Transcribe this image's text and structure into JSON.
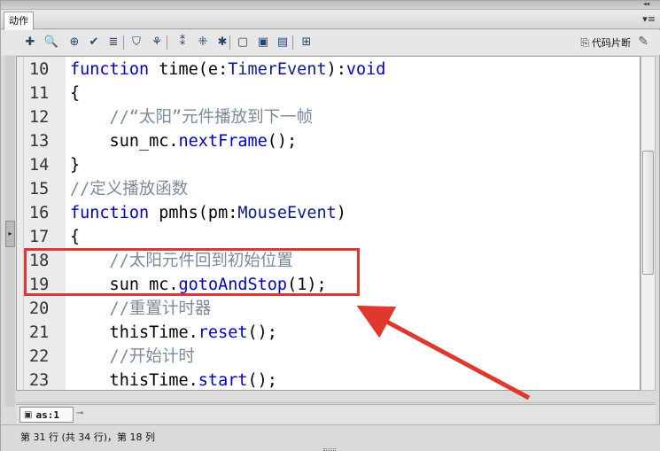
{
  "panel": {
    "tab_label": "动作",
    "collapse_glyph": "◂◂",
    "menu_glyph": "▾≡"
  },
  "toolbar": {
    "icons": [
      {
        "name": "add-script-icon",
        "glyph": "✚"
      },
      {
        "name": "find-icon",
        "glyph": "🔍"
      },
      {
        "name": "target-path-icon",
        "glyph": "⊕"
      },
      {
        "name": "check-syntax-icon",
        "glyph": "✔"
      },
      {
        "name": "auto-format-icon",
        "glyph": "≣"
      },
      {
        "name": "code-hint-icon",
        "glyph": "⛉"
      },
      {
        "name": "debug-options-icon",
        "glyph": "⚘"
      },
      {
        "name": "collapse-braces-icon",
        "glyph": "⁑"
      },
      {
        "name": "collapse-selection-icon",
        "glyph": "⁜"
      },
      {
        "name": "expand-all-icon",
        "glyph": "✱"
      },
      {
        "name": "apply-block-comment-icon",
        "glyph": "▢"
      },
      {
        "name": "apply-line-comment-icon",
        "glyph": "▣"
      },
      {
        "name": "remove-comment-icon",
        "glyph": "▤"
      },
      {
        "name": "show-hide-toolbox-icon",
        "glyph": "⊞"
      }
    ],
    "snippets_label": "代码片断",
    "snippets_glyph": "⎘",
    "wand_glyph": "✎"
  },
  "editor": {
    "lines": [
      {
        "num": "10",
        "parts": [
          {
            "t": "function",
            "c": "kw"
          },
          {
            "t": " time(e:",
            "c": ""
          },
          {
            "t": "TimerEvent",
            "c": "ty"
          },
          {
            "t": "):",
            "c": ""
          },
          {
            "t": "void",
            "c": "kw"
          }
        ]
      },
      {
        "num": "11",
        "parts": [
          {
            "t": "{",
            "c": ""
          }
        ]
      },
      {
        "num": "12",
        "parts": [
          {
            "t": "    //“太阳”元件播放到下一帧",
            "c": "cm"
          }
        ]
      },
      {
        "num": "13",
        "parts": [
          {
            "t": "    sun_mc.",
            "c": ""
          },
          {
            "t": "nextFrame",
            "c": "fn"
          },
          {
            "t": "();",
            "c": ""
          }
        ]
      },
      {
        "num": "14",
        "parts": [
          {
            "t": "}",
            "c": ""
          }
        ]
      },
      {
        "num": "15",
        "parts": [
          {
            "t": "//定义播放函数",
            "c": "cm"
          }
        ]
      },
      {
        "num": "16",
        "parts": [
          {
            "t": "function",
            "c": "kw"
          },
          {
            "t": " pmhs(pm:",
            "c": ""
          },
          {
            "t": "MouseEvent",
            "c": "ty"
          },
          {
            "t": ")",
            "c": ""
          }
        ]
      },
      {
        "num": "17",
        "parts": [
          {
            "t": "{",
            "c": ""
          }
        ]
      },
      {
        "num": "18",
        "parts": [
          {
            "t": "    //太阳元件回到初始位置",
            "c": "cm"
          }
        ]
      },
      {
        "num": "19",
        "parts": [
          {
            "t": "    sun_mc.",
            "c": ""
          },
          {
            "t": "gotoAndStop",
            "c": "fn"
          },
          {
            "t": "(1);",
            "c": ""
          }
        ]
      },
      {
        "num": "20",
        "parts": [
          {
            "t": "    //重置计时器",
            "c": "cm"
          }
        ]
      },
      {
        "num": "21",
        "parts": [
          {
            "t": "    thisTime.",
            "c": ""
          },
          {
            "t": "reset",
            "c": "fn"
          },
          {
            "t": "();",
            "c": ""
          }
        ]
      },
      {
        "num": "22",
        "parts": [
          {
            "t": "    //开始计时",
            "c": "cm"
          }
        ]
      },
      {
        "num": "23",
        "parts": [
          {
            "t": "    thisTime.",
            "c": ""
          },
          {
            "t": "start",
            "c": "fn"
          },
          {
            "t": "();",
            "c": ""
          }
        ]
      }
    ]
  },
  "file_tabs": [
    {
      "label": "as:1",
      "icon": "▣",
      "pin_glyph": "⊸"
    }
  ],
  "statusbar": {
    "text": "第 31 行 (共 34 行)，第 18 列"
  },
  "annotation": {
    "color": "#e0382f"
  },
  "colors": {
    "keyword": "#0000cc",
    "comment": "#7a8a9a",
    "gutter": "#ebebeb"
  }
}
